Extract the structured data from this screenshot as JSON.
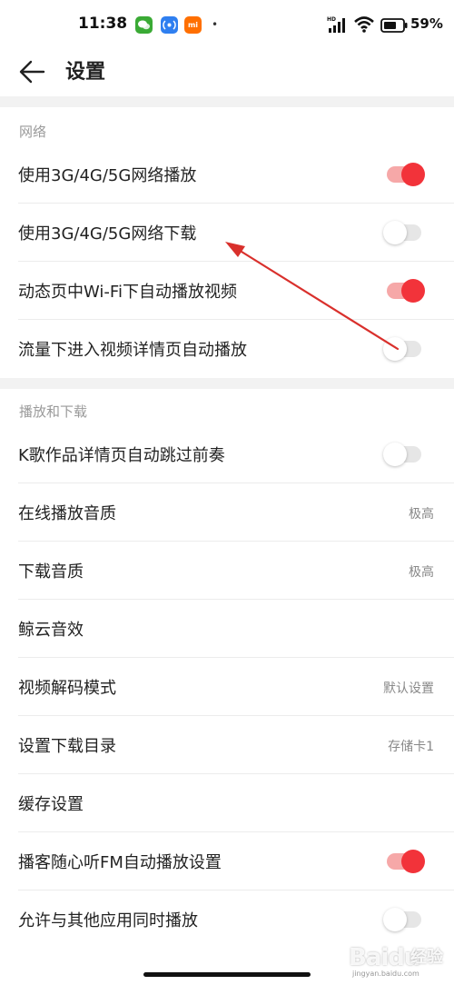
{
  "status_bar": {
    "time": "11:38",
    "battery_percent": "59%",
    "app_icon_1": "wechat-icon",
    "app_icon_2": "radio-icon",
    "app_icon_3_label": "mi",
    "notification_dot": "•"
  },
  "header": {
    "title": "设置",
    "back_icon": "arrow-left-icon"
  },
  "sections": [
    {
      "title": "网络",
      "rows": [
        {
          "label": "使用3G/4G/5G网络播放",
          "toggle": true
        },
        {
          "label": "使用3G/4G/5G网络下载",
          "toggle": false
        },
        {
          "label": "动态页中Wi-Fi下自动播放视频",
          "toggle": true
        },
        {
          "label": "流量下进入视频详情页自动播放",
          "toggle": false
        }
      ]
    },
    {
      "title": "播放和下载",
      "rows": [
        {
          "label": "K歌作品详情页自动跳过前奏",
          "toggle": false
        },
        {
          "label": "在线播放音质",
          "value": "极高"
        },
        {
          "label": "下载音质",
          "value": "极高"
        },
        {
          "label": "鲸云音效"
        },
        {
          "label": "视频解码模式",
          "value": "默认设置"
        },
        {
          "label": "设置下载目录",
          "value": "存储卡1"
        },
        {
          "label": "缓存设置"
        },
        {
          "label": "播客随心听FM自动播放设置",
          "toggle": true
        },
        {
          "label": "允许与其他应用同时播放",
          "toggle": false
        }
      ]
    }
  ],
  "colors": {
    "toggle_on": "#f2333a",
    "toggle_on_track": "#f6a8a8",
    "toggle_off_track": "#e6e6e6",
    "annotation_arrow": "#d9302c"
  },
  "watermark": {
    "brand": "Baidu",
    "sub": "经验",
    "url": "jingyan.baidu.com"
  }
}
